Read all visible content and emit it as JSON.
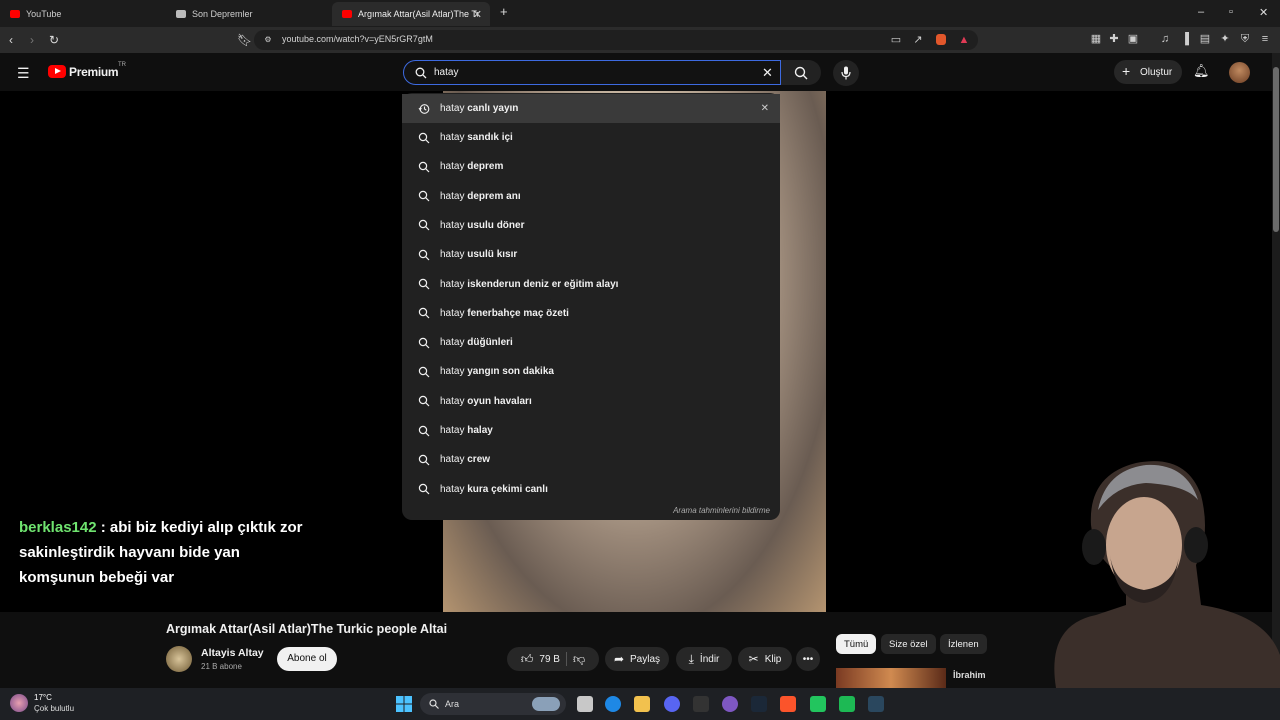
{
  "browser": {
    "tabs": [
      {
        "label": "YouTube",
        "icon": "youtube-icon"
      },
      {
        "label": "Son Depremler",
        "icon": "page-icon"
      },
      {
        "label": "Argımak Attar(Asil Atlar)The Tur",
        "icon": "youtube-icon"
      }
    ],
    "url": "youtube.com/watch?v=yEN5rGR7gtM"
  },
  "youtube": {
    "logo_text": "Premium",
    "logo_region": "TR",
    "search_value": "hatay",
    "create_label": "Oluştur",
    "suggestions": [
      {
        "prefix": "hatay ",
        "rest": "canlı yayın"
      },
      {
        "prefix": "hatay ",
        "rest": "sandık içi"
      },
      {
        "prefix": "hatay ",
        "rest": "deprem"
      },
      {
        "prefix": "hatay ",
        "rest": "deprem anı"
      },
      {
        "prefix": "hatay ",
        "rest": "usulu döner"
      },
      {
        "prefix": "hatay ",
        "rest": "usulü kısır"
      },
      {
        "prefix": "hatay ",
        "rest": "iskenderun deniz er eğitim alayı"
      },
      {
        "prefix": "hatay ",
        "rest": "fenerbahçe maç özeti"
      },
      {
        "prefix": "hatay ",
        "rest": "düğünleri"
      },
      {
        "prefix": "hatay ",
        "rest": "yangın son dakika"
      },
      {
        "prefix": "hatay ",
        "rest": "oyun havaları"
      },
      {
        "prefix": "hatay ",
        "rest": "halay"
      },
      {
        "prefix": "hatay ",
        "rest": "crew"
      },
      {
        "prefix": "hatay ",
        "rest": "kura çekimi canlı"
      }
    ],
    "report_label": "Arama tahminlerini bildirme",
    "chat": {
      "user": "berklas142",
      "message": " : abi biz kediyi alıp çıktık zor sakinleştirdik hayvanı bide yan komşunun bebeği var"
    },
    "video": {
      "title": "Argımak Attar(Asil Atlar)The Turkic people Altai",
      "channel": "Altayis Altay",
      "subscribers": "21 B abone",
      "subscribe_label": "Abone ol",
      "likes": "79 B",
      "share_label": "Paylaş",
      "download_label": "İndir",
      "clip_label": "Klip"
    },
    "chips": [
      "Tümü",
      "Size özel",
      "İzlenen"
    ],
    "recommended_title": "İbrahim"
  },
  "taskbar": {
    "temperature": "17°C",
    "weather": "Çok bulutlu",
    "search_label": "Ara"
  },
  "colors": {
    "background": "#0f0f0f",
    "accent_red": "#ff0000",
    "search_focus": "#3d6ae0",
    "chat_user": "#6fe36f"
  }
}
